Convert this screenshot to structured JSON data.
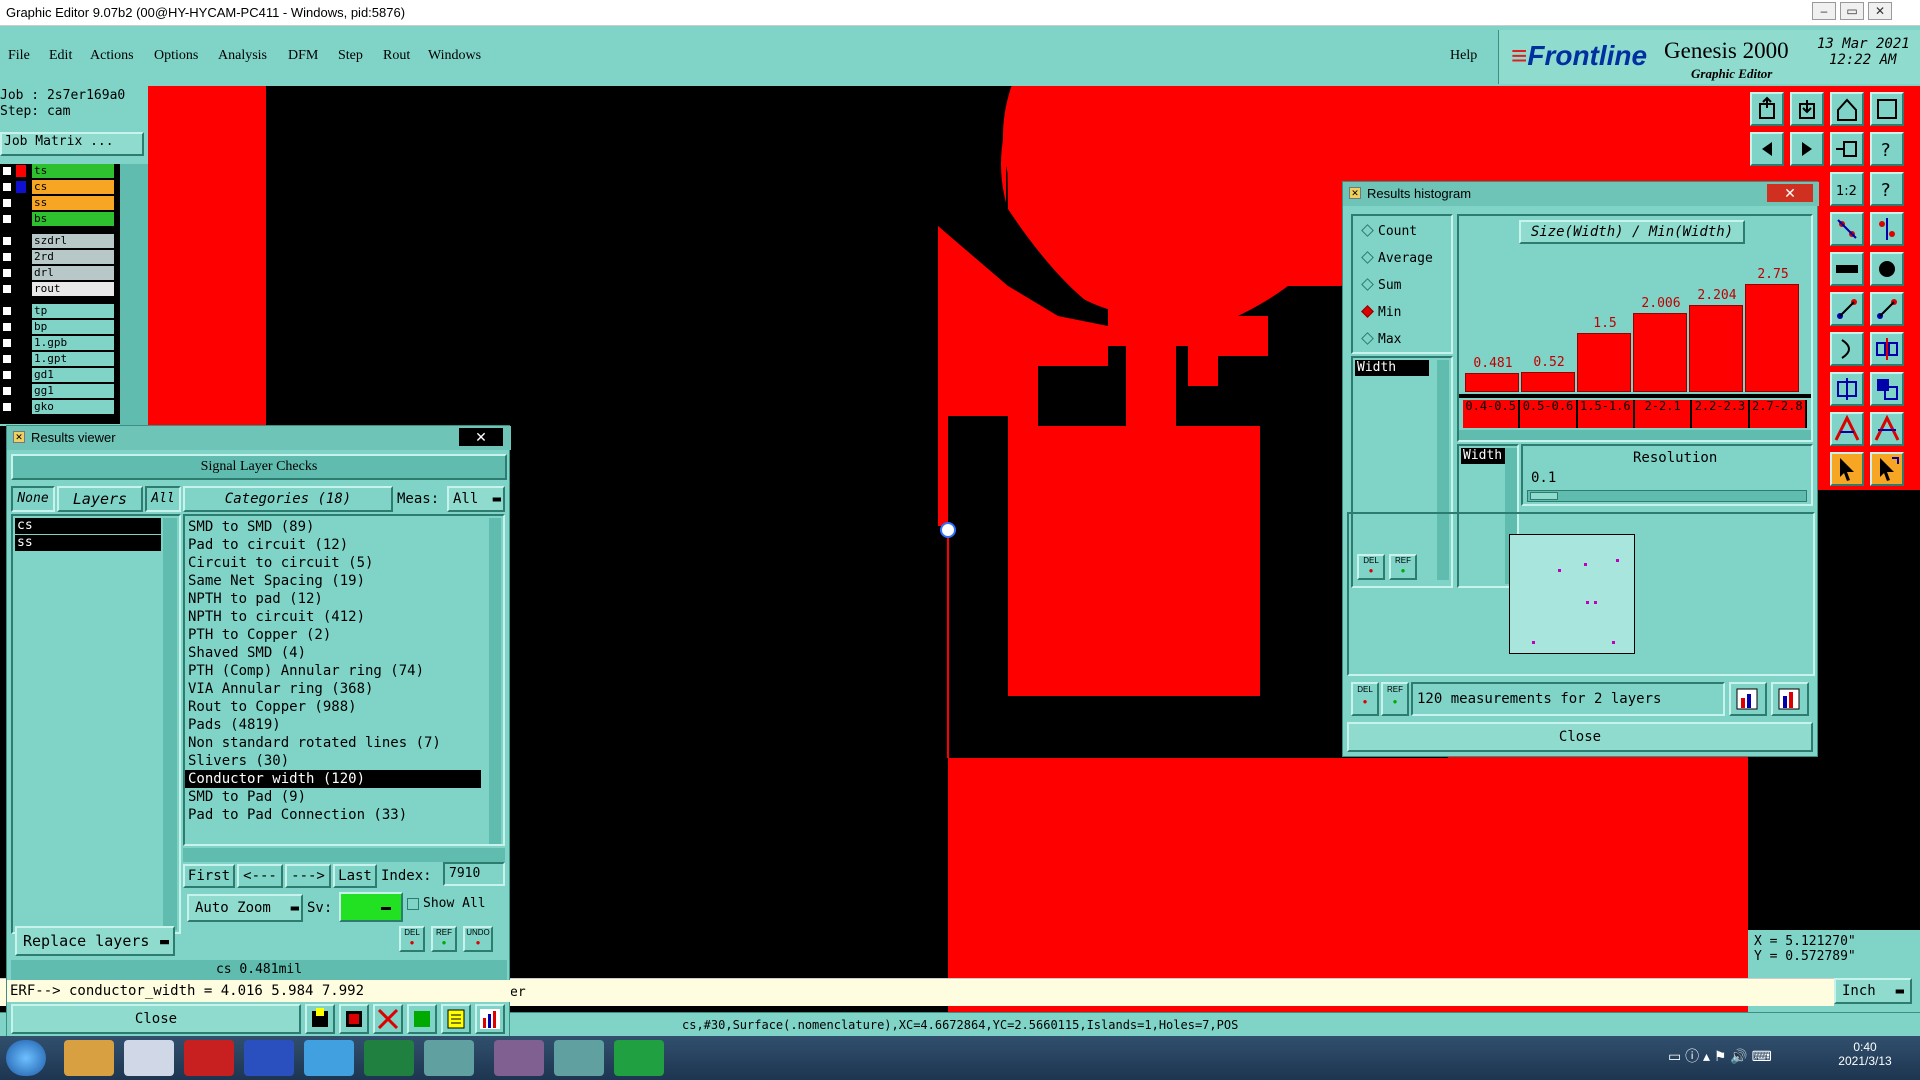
{
  "window": {
    "title": "Graphic Editor 9.07b2 (00@HY-HYCAM-PC411 - Windows, pid:5876)",
    "controls": [
      "–",
      "▭",
      "✕"
    ]
  },
  "menubar": {
    "items": [
      "File",
      "Edit",
      "Actions",
      "Options",
      "Analysis",
      "DFM",
      "Step",
      "Rout",
      "Windows"
    ],
    "help": "Help"
  },
  "brand": {
    "logo": "Frontline",
    "product": "Genesis 2000",
    "subtitle": "Graphic Editor",
    "date": "13 Mar 2021",
    "time": "12:22 AM"
  },
  "left_panel": {
    "job": "Job : 2s7er169a0",
    "step": "Step: cam",
    "job_matrix": "Job Matrix ...",
    "layers": [
      {
        "name": "ts",
        "color": "#ff0000",
        "bg": "#2ec02e"
      },
      {
        "name": "cs",
        "color": "#1010d0",
        "bg": "#f6a623"
      },
      {
        "name": "ss",
        "color": "#000000",
        "bg": "#f6a623"
      },
      {
        "name": "bs",
        "color": "#000000",
        "bg": "#2ec02e"
      },
      {
        "name": "szdrl",
        "color": "#000000",
        "bg": "#b8c8c8"
      },
      {
        "name": "2rd",
        "color": "#000000",
        "bg": "#b8c8c8"
      },
      {
        "name": "drl",
        "color": "#000000",
        "bg": "#b8c8c8"
      },
      {
        "name": "rout",
        "color": "#000000",
        "bg": "#e8e8e8"
      },
      {
        "name": "tp",
        "color": "#000000",
        "bg": "#7fd3c7"
      },
      {
        "name": "bp",
        "color": "#000000",
        "bg": "#7fd3c7"
      },
      {
        "name": "1.gpb",
        "color": "#000000",
        "bg": "#7fd3c7"
      },
      {
        "name": "1.gpt",
        "color": "#000000",
        "bg": "#7fd3c7"
      },
      {
        "name": "gd1",
        "color": "#000000",
        "bg": "#7fd3c7"
      },
      {
        "name": "gg1",
        "color": "#000000",
        "bg": "#7fd3c7"
      },
      {
        "name": "gko",
        "color": "#000000",
        "bg": "#7fd3c7"
      }
    ]
  },
  "results_viewer": {
    "title": "Results viewer",
    "header": "Signal Layer Checks",
    "tabs": {
      "none": "None",
      "layers": "Layers",
      "all": "All"
    },
    "layer_list": [
      "cs",
      "ss"
    ],
    "categories_label": "Categories (18)",
    "meas_label": "Meas:",
    "meas_value": "All",
    "categories": [
      "SMD to SMD (89)",
      "Pad to circuit (12)",
      "Circuit to circuit (5)",
      "Same Net Spacing (19)",
      "NPTH to pad (12)",
      "NPTH to circuit (412)",
      "PTH to Copper (2)",
      "Shaved SMD (4)",
      "PTH (Comp) Annular ring (74)",
      "VIA Annular ring (368)",
      "Rout to Copper (988)",
      "Pads (4819)",
      "Non standard rotated lines (7)",
      "Slivers (30)",
      "Conductor width (120)",
      "SMD to Pad (9)",
      "Pad to Pad Connection (33)"
    ],
    "selected_category": "Conductor width (120)",
    "nav": {
      "first": "First",
      "prev": "<---",
      "next": "--->",
      "last": "Last",
      "index_label": "Index:",
      "index_value": "7910"
    },
    "auto_zoom": "Auto Zoom",
    "sv_label": "Sv:",
    "show_all": "Show All",
    "replace_layers": "Replace layers",
    "small_btns": [
      "DEL",
      "REF",
      "UNDO"
    ],
    "measurement": "cs 0.481mil",
    "erf_line": "ERF--> conductor_width = 4.016 5.984 7.992",
    "close": "Close"
  },
  "histogram": {
    "title": "Results histogram",
    "options": [
      "Count",
      "Average",
      "Sum",
      "Min",
      "Max"
    ],
    "selected_option": "Min",
    "chart_title": "Size(Width) / Min(Width)",
    "list_item": "Width",
    "resolution_field": "Width",
    "resolution_label": "Resolution",
    "resolution_value": "0.1",
    "summary": "120 measurements for 2 layers",
    "small_btns": [
      "DEL",
      "REF"
    ],
    "close": "Close"
  },
  "chart_data": {
    "type": "bar",
    "title": "Size(Width) / Min(Width)",
    "categories": [
      "0.4-0.5",
      "0.5-0.6",
      "1.5-1.6",
      "2-2.1",
      "2.2-2.3",
      "2.7-2.8"
    ],
    "values": [
      0.481,
      0.52,
      1.5,
      2.006,
      2.204,
      2.75
    ],
    "value_labels": [
      "0.481",
      "0.52",
      "1.5",
      "2.006",
      "2.204",
      "2.75"
    ],
    "ylim": [
      0,
      3.1
    ]
  },
  "canvas": {
    "coord_x": "X = 5.121270\"",
    "coord_y": "Y = 0.572789\"",
    "units": "Inch",
    "status_prefix": "er",
    "feature_info": "cs,#30,Surface(.nomenclature),XC=4.6672864,YC=2.5660115,Islands=1,Holes=7,POS"
  },
  "taskbar": {
    "time": "0:40",
    "date": "2021/3/13"
  },
  "colors": {
    "panel": "#7fd3c7",
    "copper": "#ff0000",
    "background": "#000000",
    "brand_blue": "#0030a0"
  }
}
